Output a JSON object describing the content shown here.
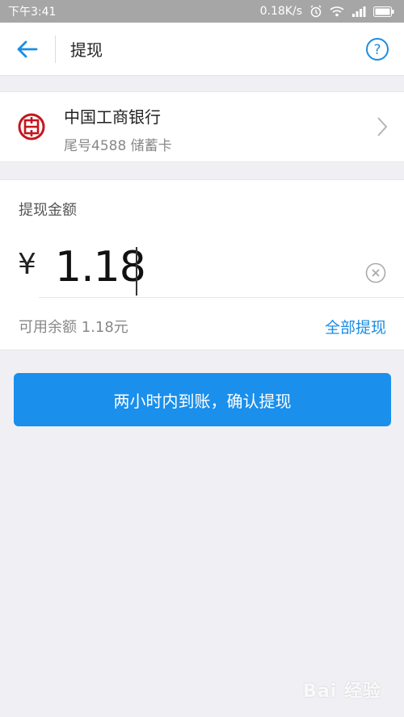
{
  "status_bar": {
    "time": "下午3:41",
    "network_speed": "0.18K/s",
    "icons": [
      "alarm-icon",
      "wifi-icon",
      "signal-icon",
      "battery-icon"
    ]
  },
  "header": {
    "title": "提现",
    "back_icon": "back-arrow-icon",
    "help_icon": "help-icon",
    "accent_color": "#1b8de3"
  },
  "bank": {
    "name": "中国工商银行",
    "card_info": "尾号4588 储蓄卡",
    "logo_color": "#c4161c"
  },
  "amount": {
    "label": "提现金额",
    "currency_symbol": "¥",
    "value": "1.18",
    "balance_text": "可用余额 1.18元",
    "withdraw_all_label": "全部提现"
  },
  "confirm_button": {
    "label": "两小时内到账，确认提现",
    "color": "#1a8feb"
  },
  "watermark": {
    "text": "Bai 经验"
  }
}
